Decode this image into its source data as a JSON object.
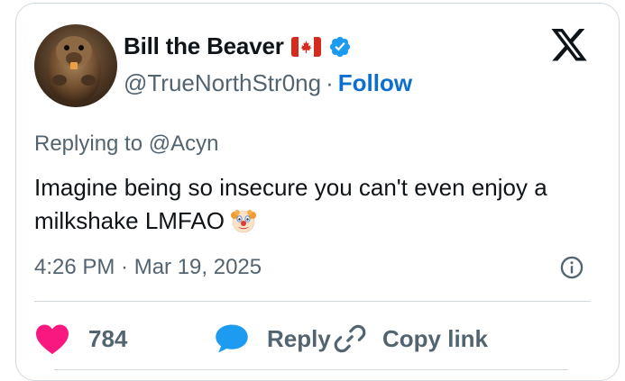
{
  "author": {
    "display_name": "Bill the Beaver",
    "flag_icon": "canada-flag-icon",
    "verified_icon": "verified-badge-icon",
    "handle": "@TrueNorthStr0ng",
    "separator": "·",
    "follow_label": "Follow"
  },
  "tweet": {
    "reply_prefix": "Replying to",
    "reply_to": "@Acyn",
    "text": "Imagine being so insecure you can't even enjoy a milkshake LMFAO",
    "emoji_icon": "clown-face-emoji",
    "timestamp": "4:26 PM · Mar 19, 2025"
  },
  "actions": {
    "like_count": "784",
    "reply_label": "Reply",
    "copy_link_label": "Copy link"
  },
  "colors": {
    "like_heart": "#f91880",
    "reply_bubble": "#1d9bf0",
    "follow_link": "#0b6fd0",
    "verified_badge": "#1d9bf0",
    "secondary_text": "#536471",
    "border": "#cfd9de"
  }
}
